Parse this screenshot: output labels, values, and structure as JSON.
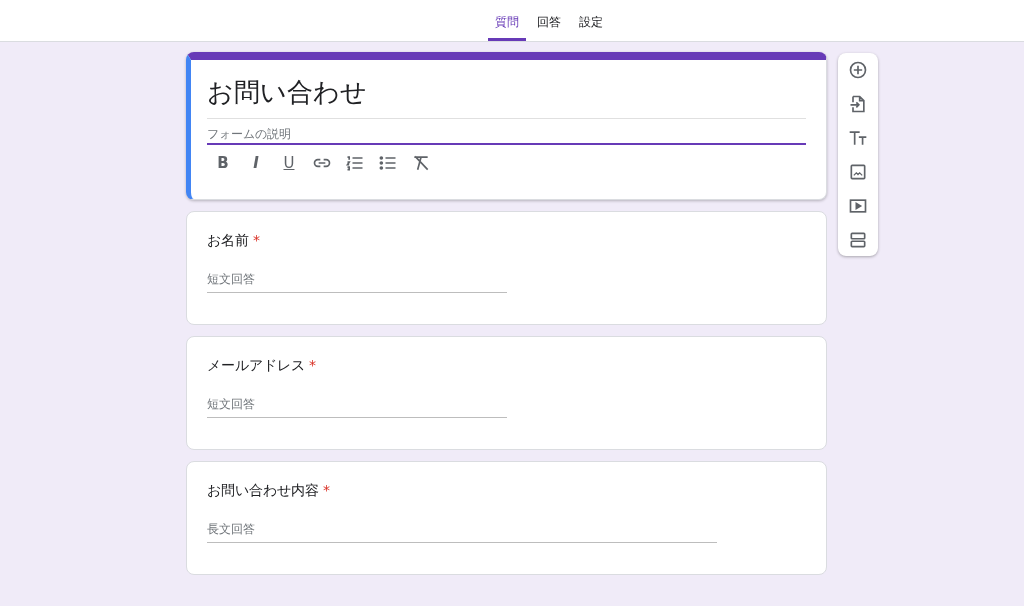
{
  "tabs": [
    {
      "label": "質問",
      "selected": true
    },
    {
      "label": "回答",
      "selected": false
    },
    {
      "label": "設定",
      "selected": false
    }
  ],
  "form": {
    "title": "お問い合わせ",
    "description": {
      "placeholder": "フォームの説明"
    },
    "format_tools": [
      {
        "kind": "bold",
        "label": "B"
      },
      {
        "kind": "italic",
        "label": "I"
      },
      {
        "kind": "underline",
        "label": "U"
      },
      {
        "kind": "link"
      },
      {
        "kind": "numbered-list"
      },
      {
        "kind": "bulleted-list"
      },
      {
        "kind": "clear-format"
      }
    ]
  },
  "questions": [
    {
      "title": "お名前",
      "required": true,
      "required_mark": "*",
      "answer": {
        "kind": "short",
        "placeholder": "短文回答"
      }
    },
    {
      "title": "メールアドレス",
      "required": true,
      "required_mark": "*",
      "answer": {
        "kind": "short",
        "placeholder": "短文回答"
      }
    },
    {
      "title": "お問い合わせ内容",
      "required": true,
      "required_mark": "*",
      "answer": {
        "kind": "long",
        "placeholder": "長文回答"
      }
    }
  ],
  "side_tools": [
    {
      "kind": "add"
    },
    {
      "kind": "import"
    },
    {
      "kind": "title"
    },
    {
      "kind": "image"
    },
    {
      "kind": "video"
    },
    {
      "kind": "section"
    }
  ]
}
